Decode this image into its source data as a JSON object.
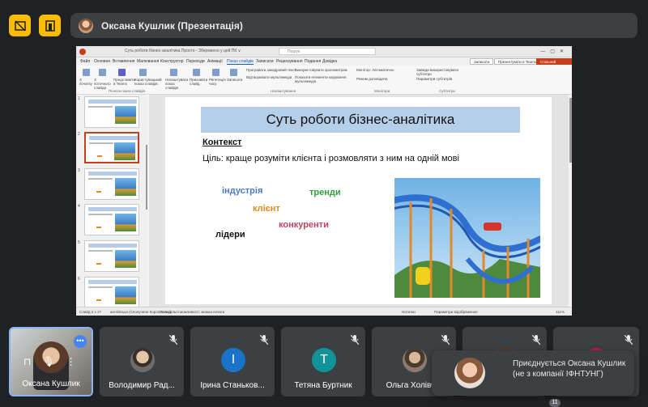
{
  "meet": {
    "presenter_chip": "Оксана Кушлик (Презентація)",
    "more_count": "11"
  },
  "ppt": {
    "window_title": "Суть роботи бізнес-аналітика Просто - Збережено у цей ПК ∨",
    "search_placeholder": "Пошук",
    "menu": [
      "Файл",
      "Основне",
      "Вставлення",
      "Малювання",
      "Конструктор",
      "Переходи",
      "Анімації",
      "Показ слайдів",
      "Записати",
      "Рецензування",
      "Подання",
      "Довідка"
    ],
    "active_menu": "Показ слайдів",
    "ribbon_buttons": [
      "З початку",
      "З поточного слайда",
      "Представити в Teams",
      "Користувацький показ слайдів",
      "Налаштувати показ слайдів",
      "Приховати слайд",
      "Репетиція часу",
      "Записати"
    ],
    "checkboxes": [
      "Програвати закадровий текст",
      "Використовувати хронометраж",
      "Відтворювати мультимедіа",
      "Показати елементи керування мультимедіа",
      "Монітор: Автоматично",
      "Режим доповідача",
      "Завжди використовувати субтитри",
      "Параметри субтитрів"
    ],
    "groups": [
      "Почати показ слайдів",
      "Налаштування",
      "Монітори",
      "Субтитри"
    ],
    "share_buttons": [
      "Записати",
      "Презентувати в Teams",
      "Спільний доступ"
    ],
    "status_left": "Слайд 2 з 17",
    "status_lang": "англійська (Сполучене Королівство)",
    "status_access": "Спеціальні можливості: можна почати",
    "status_notes": "Нотатки",
    "status_display": "Параметри відображення",
    "zoom": "111%"
  },
  "slide": {
    "title": "Суть роботи бізнес-аналітика",
    "subtitle": "Контекст",
    "body": "Ціль: краще розуміти клієнта і розмовляти з ним на одній мові",
    "words": [
      {
        "text": "індустрія",
        "color": "#4a78c8"
      },
      {
        "text": "тренди",
        "color": "#2f9e3a"
      },
      {
        "text": "клієнт",
        "color": "#e48a1a"
      },
      {
        "text": "конкуренти",
        "color": "#c0445e"
      },
      {
        "text": "лідери",
        "color": "#111111"
      }
    ]
  },
  "thumbnails": [
    "1",
    "2",
    "3",
    "4",
    "5",
    "6"
  ],
  "participants": [
    {
      "name": "Оксана Кушлик",
      "initial": ""
    },
    {
      "name": "Володимир Рад...",
      "initial": ""
    },
    {
      "name": "Ірина Станьков...",
      "initial": "І",
      "color": "#1a73c8"
    },
    {
      "name": "Тетяна Буртник",
      "initial": "Т",
      "color": "#12939a"
    },
    {
      "name": "Ольга Холівч...",
      "initial": ""
    },
    {
      "name": "",
      "initial": ""
    },
    {
      "name": "",
      "initial": ""
    }
  ],
  "toast": {
    "text": "Приєднується Оксана Кушлик (не з компанії ІФНТУНГ)"
  }
}
